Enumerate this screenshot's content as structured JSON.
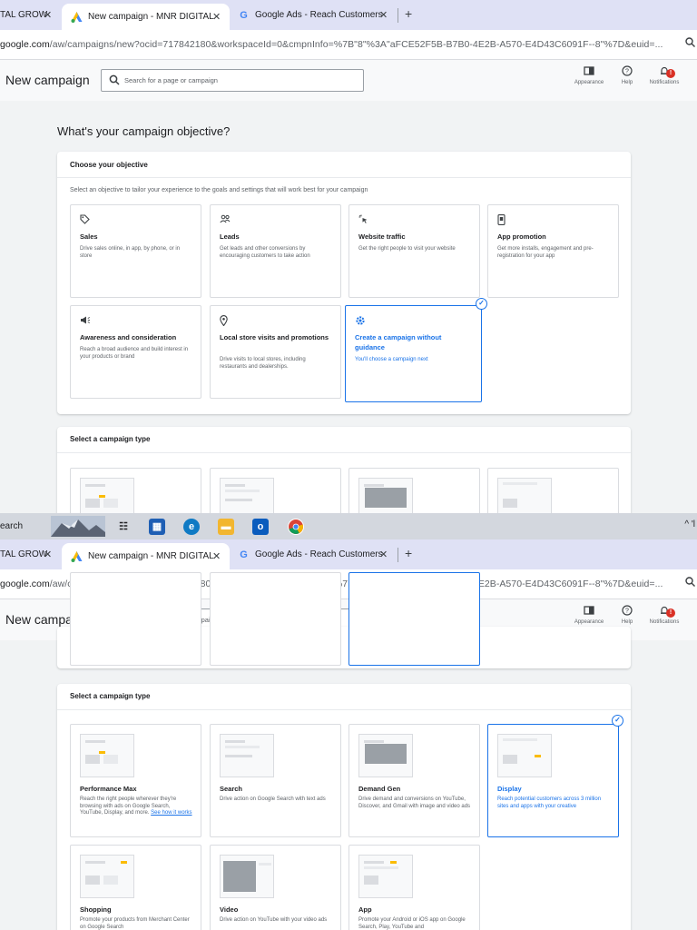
{
  "browser": {
    "tabs": [
      {
        "label": "TAL GROW",
        "active": false
      },
      {
        "label": "New campaign - MNR DIGITAL",
        "active": true
      },
      {
        "label": "Google Ads - Reach Customers",
        "active": false
      }
    ],
    "tab_close": "✕",
    "new_tab": "+",
    "url_host": "google.com",
    "url_path": "/aw/campaigns/new?ocid=717842180&workspaceId=0&cmpnInfo=%7B\"8\"%3A\"aFCE52F5B-B7B0-4E2B-A570-E4D43C6091F--8\"%7D&euid=...",
    "zoom_icon": "search-zoom-icon"
  },
  "header": {
    "title": "New campaign",
    "search_placeholder": "Search for a page or campaign",
    "tools": [
      {
        "label": "Appearance",
        "icon": "appearance-icon"
      },
      {
        "label": "Help",
        "icon": "help-icon"
      },
      {
        "label": "Notifications",
        "icon": "bell-icon",
        "badge": "!"
      }
    ]
  },
  "objective": {
    "question": "What's your campaign objective?",
    "card_title": "Choose your objective",
    "subtitle": "Select an objective to tailor your experience to the goals and settings that will work best for your campaign",
    "tiles": [
      {
        "icon": "tag-icon",
        "title": "Sales",
        "desc": "Drive sales online, in app, by phone, or in store",
        "selected": false
      },
      {
        "icon": "people-icon",
        "title": "Leads",
        "desc": "Get leads and other conversions by encouraging customers to take action",
        "selected": false
      },
      {
        "icon": "cursor-click-icon",
        "title": "Website traffic",
        "desc": "Get the right people to visit your website",
        "selected": false
      },
      {
        "icon": "phone-icon",
        "title": "App promotion",
        "desc": "Get more installs, engagement and pre-registration for your app",
        "selected": false
      },
      {
        "icon": "megaphone-icon",
        "title": "Awareness and consideration",
        "desc": "Reach a broad audience and build interest in your products or brand",
        "selected": false
      },
      {
        "icon": "location-pin-icon",
        "title": "Local store visits and promotions",
        "desc": "Drive visits to local stores, including restaurants and dealerships.",
        "selected": false
      },
      {
        "icon": "gear-icon",
        "title": "Create a campaign without guidance",
        "desc": "You'll choose a campaign next",
        "selected": true
      }
    ]
  },
  "campaign_type": {
    "card_title": "Select a campaign type",
    "types": [
      {
        "title": "Performance Max",
        "desc": "Reach the right people wherever they're browsing with ads on Google Search, YouTube, Display, and more.",
        "link": "See how it works",
        "selected": false
      },
      {
        "title": "Search",
        "desc": "Drive action on Google Search with text ads",
        "link": "",
        "selected": false
      },
      {
        "title": "Demand Gen",
        "desc": "Drive demand and conversions on YouTube, Discover, and Gmail with image and video ads",
        "link": "",
        "selected": false
      },
      {
        "title": "Display",
        "desc": "Reach potential customers across 3 million sites and apps with your creative",
        "link": "",
        "selected": true
      },
      {
        "title": "Shopping",
        "desc": "Promote your products from Merchant Center on Google Search",
        "link": "",
        "selected": false
      },
      {
        "title": "Video",
        "desc": "Drive action on YouTube with your video ads",
        "link": "",
        "selected": false
      },
      {
        "title": "App",
        "desc": "Promote your Android or iOS app on Google Search, Play, YouTube and",
        "link": "",
        "selected": false
      }
    ]
  },
  "taskbar": {
    "search_label": "earch",
    "apps": [
      "task-view-icon",
      "store-icon",
      "edge-icon",
      "file-explorer-icon",
      "outlook-icon",
      "chrome-icon"
    ],
    "tray_text": "^ 'l"
  }
}
